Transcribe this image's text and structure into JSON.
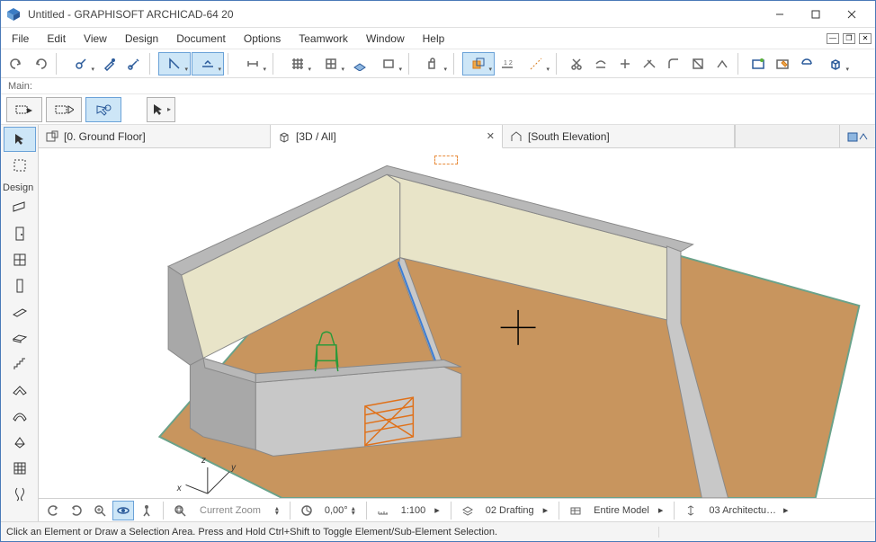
{
  "window": {
    "title": "Untitled - GRAPHISOFT ARCHICAD-64 20"
  },
  "menu": {
    "items": [
      "File",
      "Edit",
      "View",
      "Design",
      "Document",
      "Options",
      "Teamwork",
      "Window",
      "Help"
    ]
  },
  "infobar": {
    "label": "Main:"
  },
  "toolbox": {
    "section_label": "Design"
  },
  "tabs": [
    {
      "icon": "floorplan-icon",
      "label": "[0. Ground Floor]",
      "active": false,
      "closable": false
    },
    {
      "icon": "cube-icon",
      "label": "[3D / All]",
      "active": true,
      "closable": true
    },
    {
      "icon": "elevation-icon",
      "label": "[South Elevation]",
      "active": false,
      "closable": false
    }
  ],
  "zoombar": {
    "current_zoom_label": "Current Zoom",
    "angle": "0,00°",
    "scale": "1:100",
    "layer_combo": "02 Drafting",
    "model_view": "Entire Model",
    "dim_standard": "03 Architectu…"
  },
  "status": {
    "hint": "Click an Element or Draw a Selection Area. Press and Hold Ctrl+Shift to Toggle Element/Sub-Element Selection."
  }
}
